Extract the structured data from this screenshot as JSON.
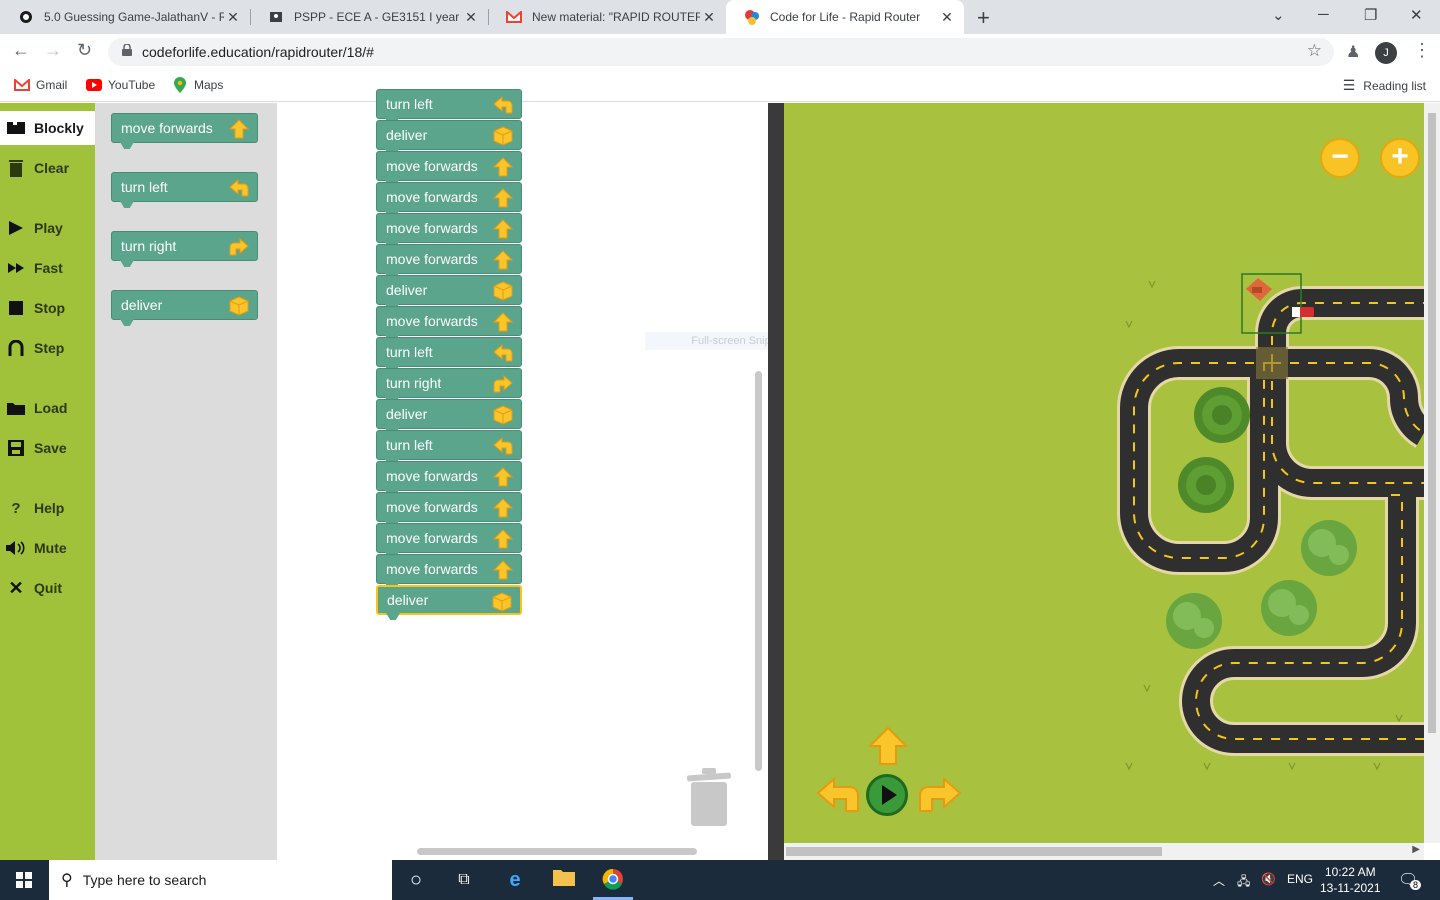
{
  "browser": {
    "tabs": [
      {
        "title": "5.0 Guessing Game-JalathanV - R",
        "icon": "replit-icon"
      },
      {
        "title": "PSPP - ECE A - GE3151 I year ECE",
        "icon": "classroom-icon"
      },
      {
        "title": "New material: \"RAPID ROUTER LE",
        "icon": "gmail-icon"
      },
      {
        "title": "Code for Life - Rapid Router",
        "icon": "codeforlife-icon"
      }
    ],
    "url": "codeforlife.education/rapidrouter/18/#",
    "profile_initial": "J",
    "bookmarks": [
      "Gmail",
      "YouTube",
      "Maps"
    ],
    "reading_list": "Reading list"
  },
  "sidemenu": {
    "items": [
      "Blockly",
      "Clear",
      "Play",
      "Fast",
      "Stop",
      "Step",
      "Load",
      "Save",
      "Help",
      "Mute",
      "Quit"
    ],
    "active": "Blockly"
  },
  "toolbox": {
    "blocks": [
      {
        "label": "move forwards",
        "icon": "up-arrow-icon"
      },
      {
        "label": "turn left",
        "icon": "left-arrow-icon"
      },
      {
        "label": "turn right",
        "icon": "right-arrow-icon"
      },
      {
        "label": "deliver",
        "icon": "box-icon"
      }
    ]
  },
  "program": {
    "blocks": [
      {
        "label": "turn left",
        "icon": "left-arrow-icon"
      },
      {
        "label": "deliver",
        "icon": "box-icon"
      },
      {
        "label": "move forwards",
        "icon": "up-arrow-icon"
      },
      {
        "label": "move forwards",
        "icon": "up-arrow-icon"
      },
      {
        "label": "move forwards",
        "icon": "up-arrow-icon"
      },
      {
        "label": "move forwards",
        "icon": "up-arrow-icon"
      },
      {
        "label": "deliver",
        "icon": "box-icon"
      },
      {
        "label": "move forwards",
        "icon": "up-arrow-icon"
      },
      {
        "label": "turn left",
        "icon": "left-arrow-icon"
      },
      {
        "label": "turn right",
        "icon": "right-arrow-icon"
      },
      {
        "label": "deliver",
        "icon": "box-icon"
      },
      {
        "label": "turn left",
        "icon": "left-arrow-icon"
      },
      {
        "label": "move forwards",
        "icon": "up-arrow-icon"
      },
      {
        "label": "move forwards",
        "icon": "up-arrow-icon"
      },
      {
        "label": "move forwards",
        "icon": "up-arrow-icon"
      },
      {
        "label": "move forwards",
        "icon": "up-arrow-icon"
      },
      {
        "label": "deliver",
        "icon": "box-icon"
      }
    ],
    "selected_index": 16
  },
  "overlay_hint": "Full-screen Snip",
  "map": {
    "zoom_out": "−",
    "zoom_in": "+",
    "colors": {
      "grass": "#a8c23f",
      "road": "#2f2f2f",
      "kerb": "#e6d8a6",
      "lane": "#f5c518"
    }
  },
  "taskbar": {
    "search_placeholder": "Type here to search",
    "lang": "ENG",
    "time": "10:22 AM",
    "date": "13-11-2021",
    "notifications": "8"
  }
}
